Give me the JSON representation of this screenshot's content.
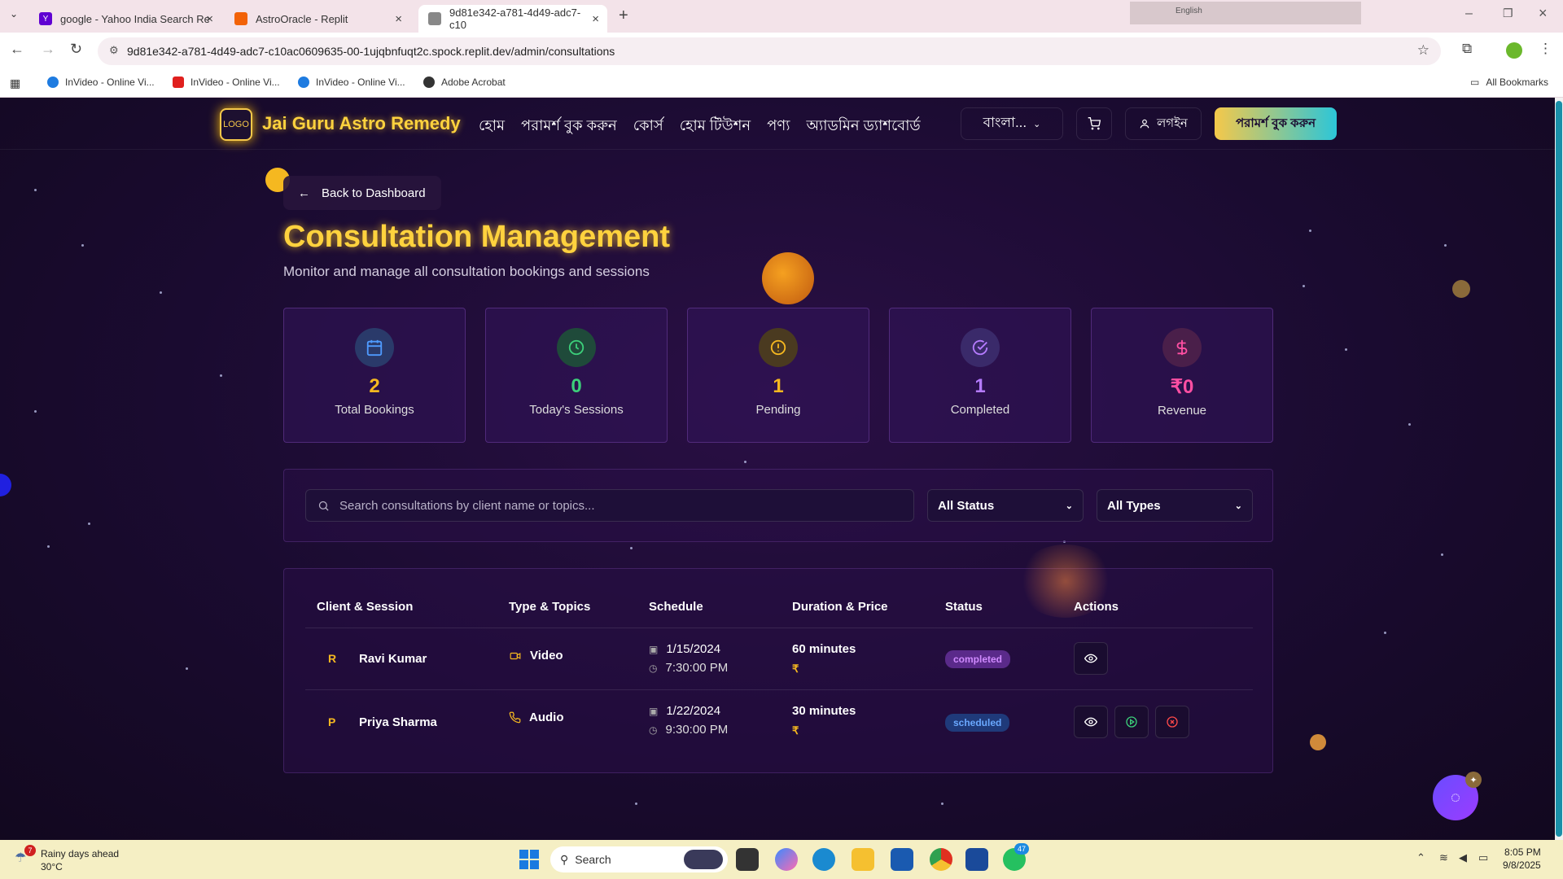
{
  "browser": {
    "tabs": [
      {
        "label": "google - Yahoo India Search Re"
      },
      {
        "label": "AstroOracle - Replit"
      },
      {
        "label": "9d81e342-a781-4d49-adc7-c10"
      }
    ],
    "url": "9d81e342-a781-4d49-adc7-c10ac0609635-00-1ujqbnfuqt2c.spock.replit.dev/admin/consultations",
    "bookmarks": [
      "InVideo - Online Vi...",
      "InVideo - Online Vi...",
      "InVideo - Online Vi...",
      "Adobe Acrobat"
    ],
    "all_bookmarks": "All Bookmarks",
    "translate_label": "English"
  },
  "header": {
    "logo_text": "LOGO",
    "brand": "Jai Guru Astro Remedy",
    "nav": [
      "হোম",
      "পরামর্শ বুক করুন",
      "কোর্স",
      "হোম টিউশন",
      "পণ্য",
      "অ্যাডমিন ড্যাশবোর্ড"
    ],
    "language": "বাংলা...",
    "login": "লগইন",
    "cta": "পরামর্শ বুক করুন"
  },
  "page": {
    "back": "Back to Dashboard",
    "title": "Consultation Management",
    "subtitle": "Monitor and manage all consultation bookings and sessions"
  },
  "stats": [
    {
      "value": "2",
      "label": "Total Bookings",
      "color": "#f5b820",
      "icon": "calendar-icon"
    },
    {
      "value": "0",
      "label": "Today's Sessions",
      "color": "#3ccf7a",
      "icon": "clock-icon"
    },
    {
      "value": "1",
      "label": "Pending",
      "color": "#f5b820",
      "icon": "alert-icon"
    },
    {
      "value": "1",
      "label": "Completed",
      "color": "#b57bff",
      "icon": "check-circle-icon"
    },
    {
      "value": "₹0",
      "label": "Revenue",
      "color": "#ff4fa3",
      "icon": "dollar-icon"
    }
  ],
  "filters": {
    "search_placeholder": "Search consultations by client name or topics...",
    "status": "All Status",
    "types": "All Types"
  },
  "table": {
    "headers": [
      "Client & Session",
      "Type & Topics",
      "Schedule",
      "Duration & Price",
      "Status",
      "Actions"
    ],
    "rows": [
      {
        "initial": "R",
        "name": "Ravi Kumar",
        "type": "Video",
        "date": "1/15/2024",
        "time": "7:30:00 PM",
        "duration": "60 minutes",
        "price": "₹",
        "status": "completed"
      },
      {
        "initial": "P",
        "name": "Priya Sharma",
        "type": "Audio",
        "date": "1/22/2024",
        "time": "9:30:00 PM",
        "duration": "30 minutes",
        "price": "₹",
        "status": "scheduled"
      }
    ]
  },
  "taskbar": {
    "weather_title": "Rainy days ahead",
    "weather_temp": "30°C",
    "weather_badge": "7",
    "search": "Search",
    "whatsapp_badge": "47",
    "time": "8:05 PM",
    "date": "9/8/2025"
  }
}
